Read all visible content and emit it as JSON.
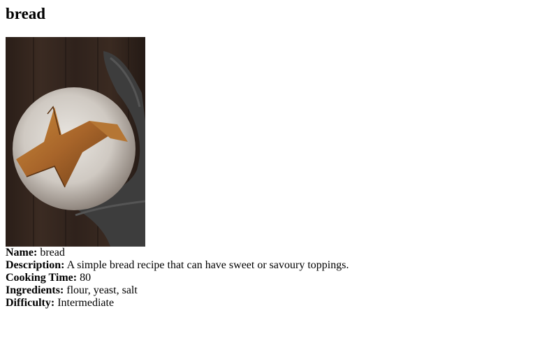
{
  "recipe": {
    "title": "bread",
    "image_alt": "bread",
    "fields": {
      "name": {
        "label": "Name:",
        "value": "bread"
      },
      "description": {
        "label": "Description:",
        "value": "A simple bread recipe that can have sweet or savoury toppings."
      },
      "cooking_time": {
        "label": "Cooking Time:",
        "value": "80"
      },
      "ingredients": {
        "label": "Ingredients:",
        "value": "flour, yeast, salt"
      },
      "difficulty": {
        "label": "Difficulty:",
        "value": "Intermediate"
      }
    }
  }
}
